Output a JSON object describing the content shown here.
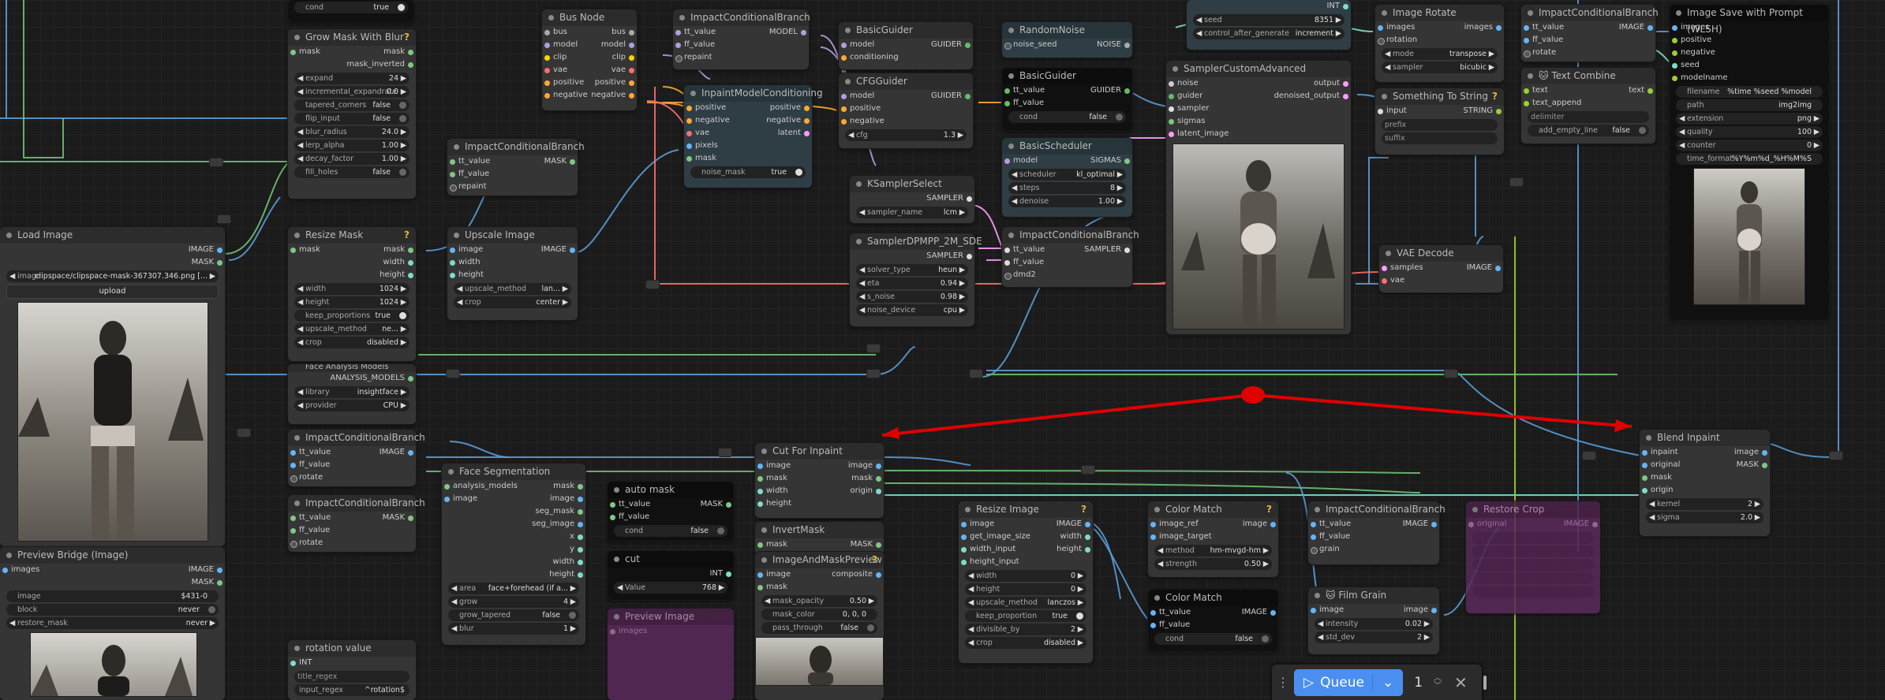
{
  "nodes": {
    "top_fragment": {
      "cond": "cond",
      "cond_value": "true"
    },
    "grow_mask": {
      "title": "Grow Mask With Blur",
      "in_mask": "mask",
      "out_mask": "mask",
      "out_mask_inverted": "mask_inverted",
      "expand": [
        "expand",
        "24"
      ],
      "incremental": [
        "incremental_expandrate",
        "0.0"
      ],
      "tapered": [
        "tapered_corners",
        "false"
      ],
      "flip": [
        "flip_input",
        "false"
      ],
      "blur_radius": [
        "blur_radius",
        "24.0"
      ],
      "lerp": [
        "lerp_alpha",
        "1.00"
      ],
      "decay": [
        "decay_factor",
        "1.00"
      ],
      "fill": [
        "fill_holes",
        "false"
      ]
    },
    "bus_node": {
      "title": "Bus Node",
      "ports": [
        "bus",
        "model",
        "clip",
        "vae",
        "positive",
        "negative"
      ]
    },
    "icb1": {
      "title": "ImpactConditionalBranch",
      "in": [
        "tt_value",
        "ff_value"
      ],
      "out": "MODEL",
      "widget": "repaint"
    },
    "inpaint_mc": {
      "title": "InpaintModelConditioning",
      "in": [
        "positive",
        "negative",
        "vae",
        "pixels",
        "mask"
      ],
      "out": [
        "positive",
        "negative",
        "latent"
      ],
      "noise_mask": [
        "noise_mask",
        "true"
      ]
    },
    "basic_guider1": {
      "title": "BasicGuider",
      "in": [
        "model",
        "conditioning"
      ],
      "out": "GUIDER"
    },
    "cfg_guider": {
      "title": "CFGGuider",
      "in": [
        "model",
        "positive",
        "negative"
      ],
      "out": "GUIDER",
      "cfg": [
        "cfg",
        "1.3"
      ]
    },
    "random_noise": {
      "title": "RandomNoise",
      "in": "noise_seed",
      "out": "NOISE"
    },
    "basic_guider2": {
      "title": "BasicGuider",
      "in": [
        "tt_value",
        "ff_value"
      ],
      "out": "GUIDER",
      "cond": [
        "cond",
        "false"
      ]
    },
    "basic_scheduler": {
      "title": "BasicScheduler",
      "in": "model",
      "out": "SIGMAS",
      "scheduler": [
        "scheduler",
        "kl_optimal"
      ],
      "steps": [
        "steps",
        "8"
      ],
      "denoise": [
        "denoise",
        "1.00"
      ]
    },
    "ksampler_select": {
      "title": "KSamplerSelect",
      "out": "SAMPLER",
      "sampler_name": [
        "sampler_name",
        "lcm"
      ]
    },
    "sampler_dpmpp": {
      "title": "SamplerDPMPP_2M_SDE",
      "out": "SAMPLER",
      "solver_type": [
        "solver_type",
        "heun"
      ],
      "eta": [
        "eta",
        "0.94"
      ],
      "s_noise": [
        "s_noise",
        "0.98"
      ],
      "noise_device": [
        "noise_device",
        "cpu"
      ]
    },
    "icb_sampler": {
      "title": "ImpactConditionalBranch",
      "in": [
        "tt_value",
        "ff_value"
      ],
      "out": "SAMPLER",
      "widget": "dmd2"
    },
    "seed_node": {
      "out": "INT",
      "seed": [
        "seed",
        "8351"
      ],
      "control": [
        "control_after_generate",
        "increment"
      ]
    },
    "sampler_custom": {
      "title": "SamplerCustomAdvanced",
      "in": [
        "noise",
        "guider",
        "sampler",
        "sigmas",
        "latent_image"
      ],
      "out": [
        "output",
        "denoised_output"
      ]
    },
    "image_rotate": {
      "title": "Image Rotate",
      "in": [
        "images",
        "rotation"
      ],
      "out": "images",
      "mode": [
        "mode",
        "transpose"
      ],
      "sampler": [
        "sampler",
        "bicubic"
      ]
    },
    "something_to_string": {
      "title": "Something To String",
      "in": "input",
      "out": "STRING",
      "prefix": "prefix",
      "suffix": "suffix"
    },
    "icb_image_top": {
      "title": "ImpactConditionalBranch",
      "in": [
        "tt_value",
        "ff_value"
      ],
      "out": "IMAGE",
      "widget": "rotate"
    },
    "text_combine": {
      "title": "🐱 Text Combine",
      "in": [
        "text",
        "text_append"
      ],
      "out": "text",
      "delimiter": "delimiter",
      "add_empty_line": [
        "add_empty_line",
        "false"
      ]
    },
    "image_save": {
      "title": "Image Save with Prompt (WLSH)",
      "in": [
        "images",
        "positive",
        "negative",
        "seed",
        "modelname"
      ],
      "filename": [
        "filename",
        "%time %seed %model"
      ],
      "path": [
        "path",
        "img2img"
      ],
      "extension": [
        "extension",
        "png"
      ],
      "quality": [
        "quality",
        "100"
      ],
      "counter": [
        "counter",
        "0"
      ],
      "time_format": [
        "time_format",
        "%Y%m%d_%H%M%S"
      ]
    },
    "vae_decode": {
      "title": "VAE Decode",
      "in": [
        "samples",
        "vae"
      ],
      "out": "IMAGE"
    },
    "icb_mask1": {
      "title": "ImpactConditionalBranch",
      "in": [
        "tt_value",
        "ff_value"
      ],
      "out": "MASK",
      "widget": "repaint"
    },
    "load_image": {
      "title": "Load Image",
      "out": [
        "IMAGE",
        "MASK"
      ],
      "image": [
        "image",
        "clipspace/clipspace-mask-367307.346.png [..."
      ],
      "upload": "upload"
    },
    "resize_mask": {
      "title": "Resize Mask",
      "in": "mask",
      "out": [
        "mask",
        "width",
        "height"
      ],
      "width": [
        "width",
        "1024"
      ],
      "height": [
        "height",
        "1024"
      ],
      "keep": [
        "keep_proportions",
        "true"
      ],
      "upscale": [
        "upscale_method",
        "ne..."
      ],
      "crop": [
        "crop",
        "disabled"
      ]
    },
    "upscale_image": {
      "title": "Upscale Image",
      "in": [
        "image",
        "width",
        "height"
      ],
      "out": "IMAGE",
      "upscale": [
        "upscale_method",
        "lan..."
      ],
      "crop": [
        "crop",
        "center"
      ]
    },
    "face_analysis_models": {
      "title": "Face Analysis Models",
      "out": "ANALYSIS_MODELS",
      "library": [
        "library",
        "insightface"
      ],
      "provider": [
        "provider",
        "CPU"
      ]
    },
    "icb_image_mid": {
      "title": "ImpactConditionalBranch",
      "in": [
        "tt_value",
        "ff_value"
      ],
      "out": "IMAGE",
      "widget": "rotate"
    },
    "icb_mask_mid": {
      "title": "ImpactConditionalBranch",
      "in": [
        "tt_value",
        "ff_value"
      ],
      "out": "MASK",
      "widget": "rotate"
    },
    "face_seg": {
      "title": "Face Segmentation",
      "in": [
        "analysis_models",
        "image"
      ],
      "out": [
        "mask",
        "image",
        "seg_mask",
        "seg_image",
        "x",
        "y",
        "width",
        "height"
      ],
      "area": [
        "area",
        "face+forehead (if a..."
      ],
      "grow": [
        "grow",
        "4"
      ],
      "grow_tapered": [
        "grow_tapered",
        "false"
      ],
      "blur": [
        "blur",
        "1"
      ]
    },
    "auto_mask": {
      "title": "auto mask",
      "in": [
        "tt_value",
        "ff_value"
      ],
      "out": "MASK",
      "cond": [
        "cond",
        "false"
      ]
    },
    "cut": {
      "title": "cut",
      "out": "INT",
      "value": [
        "Value",
        "768"
      ]
    },
    "preview_image": {
      "title": "Preview Image",
      "in": "images"
    },
    "cut_for_inpaint": {
      "title": "Cut For Inpaint",
      "in": [
        "image",
        "mask",
        "width",
        "height"
      ],
      "out": [
        "image",
        "mask",
        "origin"
      ]
    },
    "invert_mask": {
      "title": "InvertMask",
      "in": "mask",
      "out": "MASK"
    },
    "img_mask_preview": {
      "title": "ImageAndMaskPreview",
      "in": [
        "image",
        "mask"
      ],
      "out": "composite",
      "opacity": [
        "mask_opacity",
        "0.50"
      ],
      "color": [
        "mask_color",
        "0, 0, 0"
      ],
      "pass": [
        "pass_through",
        "false"
      ]
    },
    "resize_image": {
      "title": "Resize Image",
      "in": [
        "image",
        "get_image_size",
        "width_input",
        "height_input"
      ],
      "out": [
        "IMAGE",
        "width",
        "height"
      ],
      "width": [
        "width",
        "0"
      ],
      "height": [
        "height",
        "0"
      ],
      "upscale": [
        "upscale_method",
        "lanczos"
      ],
      "keep": [
        "keep_proportion",
        "true"
      ],
      "divisible": [
        "divisible_by",
        "2"
      ],
      "crop": [
        "crop",
        "disabled"
      ]
    },
    "color_match1": {
      "title": "Color Match",
      "in": [
        "image_ref",
        "image_target"
      ],
      "out": "image",
      "method": [
        "method",
        "hm-mvgd-hm"
      ],
      "strength": [
        "strength",
        "0.50"
      ]
    },
    "color_match2": {
      "title": "Color Match",
      "in": [
        "tt_value",
        "ff_value"
      ],
      "out": "IMAGE",
      "cond": [
        "cond",
        "false"
      ]
    },
    "icb_grain": {
      "title": "ImpactConditionalBranch",
      "in": [
        "tt_value",
        "ff_value"
      ],
      "out": "IMAGE",
      "widget": "grain"
    },
    "film_grain": {
      "title": "🐱 Film Grain",
      "in": "image",
      "out": "image",
      "intensity": [
        "intensity",
        "0.02"
      ],
      "std_dev": [
        "std_dev",
        "2"
      ]
    },
    "restore_crop": {
      "title": "Restore Crop",
      "in": "original",
      "out": "IMAGE"
    },
    "blend_inpaint": {
      "title": "Blend Inpaint",
      "in": [
        "inpaint",
        "original",
        "mask",
        "origin"
      ],
      "out": [
        "image",
        "MASK"
      ],
      "kernel": [
        "kernel",
        "2"
      ],
      "sigma": [
        "sigma",
        "2.0"
      ]
    },
    "preview_bridge": {
      "title": "Preview Bridge (Image)",
      "in": "images",
      "out": [
        "IMAGE",
        "MASK"
      ],
      "image": [
        "image",
        "$431-0"
      ],
      "block": [
        "block",
        "never"
      ],
      "restore": [
        "restore_mask",
        "never"
      ]
    },
    "rotation_value": {
      "title": "rotation value",
      "out": "INT",
      "title_regex": "title_regex",
      "input_regex": [
        "input_regex",
        "^rotation$"
      ]
    }
  },
  "queue": {
    "label": "Queue",
    "count": "1"
  },
  "colors": {
    "image": "#64b5f6",
    "mask": "#81c784",
    "model": "#b39ddb",
    "clip": "#ffd500",
    "vae": "#ff6e6e",
    "cond": "#ffa931",
    "latent": "#ff9cf9",
    "int": "#7fdbca",
    "accent": "#e00000"
  }
}
